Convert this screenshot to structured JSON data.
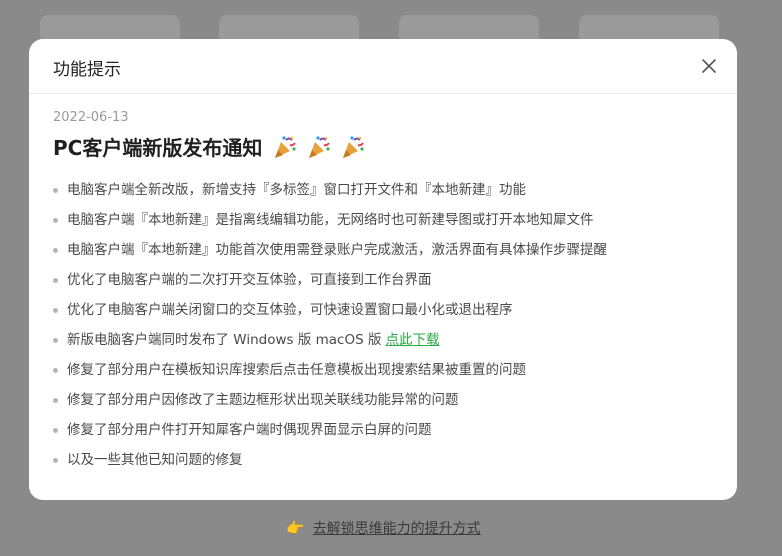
{
  "background": {
    "link_text": "去解锁思维能力的提升方式"
  },
  "modal": {
    "title": "功能提示",
    "date": "2022-06-13",
    "heading": "PC客户端新版发布通知",
    "items": [
      "电脑客户端全新改版，新增支持『多标签』窗口打开文件和『本地新建』功能",
      "电脑客户端『本地新建』是指离线编辑功能，无网络时也可新建导图或打开本地知犀文件",
      "电脑客户端『本地新建』功能首次使用需登录账户完成激活，激活界面有具体操作步骤提醒",
      "优化了电脑客户端的二次打开交互体验，可直接到工作台界面",
      "优化了电脑客户端关闭窗口的交互体验，可快速设置窗口最小化或退出程序",
      "新版电脑客户端同时发布了 Windows 版 macOS 版",
      "修复了部分用户在模板知识库搜索后点击任意模板出现搜索结果被重置的问题",
      "修复了部分用户因修改了主题边框形状出现关联线功能异常的问题",
      "修复了部分用户件打开知犀客户端时偶现界面显示白屏的问题",
      "以及一些其他已知问题的修复"
    ],
    "download_link": "点此下载"
  },
  "colors": {
    "overlay": "#8a8a8a",
    "link_green": "#2aaa42"
  },
  "icons": [
    "close-icon",
    "party-popper-icon",
    "pointing-hand-icon"
  ]
}
